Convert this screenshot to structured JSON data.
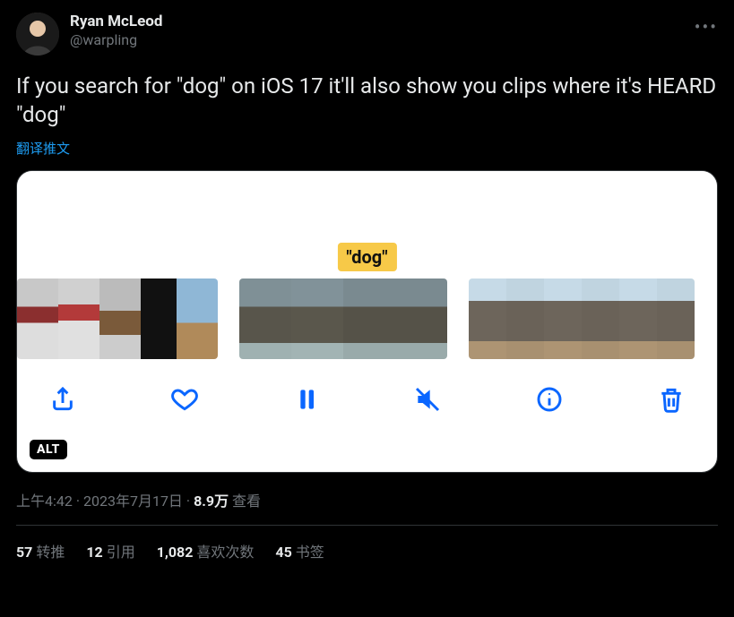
{
  "author": {
    "display_name": "Ryan McLeod",
    "handle": "@warpling"
  },
  "tweet_text": "If you search for \"dog\" on iOS 17 it'll also show you clips where it's HEARD \"dog\"",
  "translate_label": "翻译推文",
  "media": {
    "caption_badge": "\"dog\"",
    "alt_label": "ALT",
    "toolbar": {
      "share": "share-icon",
      "like": "heart-icon",
      "pause": "pause-icon",
      "mute": "mute-icon",
      "info": "info-icon",
      "delete": "trash-icon"
    }
  },
  "meta": {
    "time": "上午4:42",
    "sep": " · ",
    "date": "2023年7月17日",
    "views_count": "8.9万",
    "views_label": " 查看"
  },
  "stats": {
    "retweets": {
      "count": "57",
      "label": "转推"
    },
    "quotes": {
      "count": "12",
      "label": "引用"
    },
    "likes": {
      "count": "1,082",
      "label": "喜欢次数"
    },
    "bookmarks": {
      "count": "45",
      "label": "书签"
    }
  }
}
